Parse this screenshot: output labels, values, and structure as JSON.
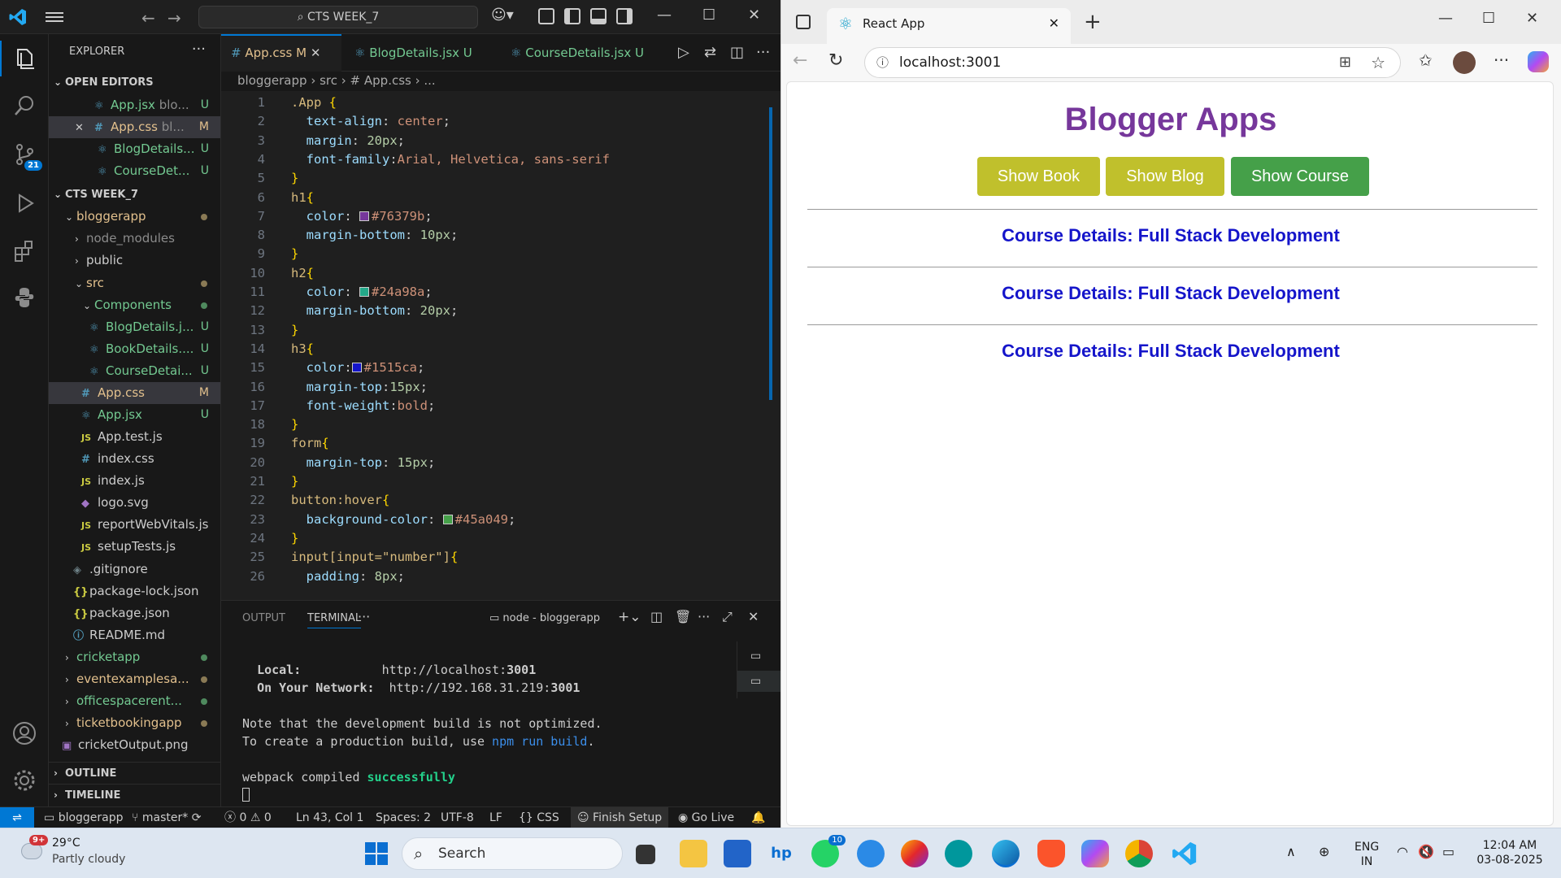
{
  "vscode": {
    "search_text": "CTS WEEK_7",
    "explorer_title": "EXPLORER",
    "open_editors_label": "OPEN EDITORS",
    "open_editors": [
      {
        "name": "App.jsx",
        "hint": "blo...",
        "status": "U"
      },
      {
        "name": "App.css",
        "hint": "bl...",
        "status": "M"
      },
      {
        "name": "BlogDetails...",
        "hint": "",
        "status": "U"
      },
      {
        "name": "CourseDet...",
        "hint": "",
        "status": "U"
      }
    ],
    "workspace_label": "CTS WEEK_7",
    "tree": [
      {
        "name": "bloggerapp",
        "kind": "folder-open"
      },
      {
        "name": "node_modules",
        "kind": "folder"
      },
      {
        "name": "public",
        "kind": "folder"
      },
      {
        "name": "src",
        "kind": "folder-open"
      },
      {
        "name": "Components",
        "kind": "folder-open"
      },
      {
        "name": "BlogDetails.j...",
        "status": "U"
      },
      {
        "name": "BookDetails....",
        "status": "U"
      },
      {
        "name": "CourseDetai...",
        "status": "U"
      },
      {
        "name": "App.css",
        "status": "M"
      },
      {
        "name": "App.jsx",
        "status": "U"
      },
      {
        "name": "App.test.js",
        "status": ""
      },
      {
        "name": "index.css",
        "status": ""
      },
      {
        "name": "index.js",
        "status": ""
      },
      {
        "name": "logo.svg",
        "status": ""
      },
      {
        "name": "reportWebVitals.js",
        "status": ""
      },
      {
        "name": "setupTests.js",
        "status": ""
      },
      {
        "name": ".gitignore",
        "status": ""
      },
      {
        "name": "package-lock.json",
        "status": ""
      },
      {
        "name": "package.json",
        "status": ""
      },
      {
        "name": "README.md",
        "status": ""
      },
      {
        "name": "cricketapp",
        "kind": "folder"
      },
      {
        "name": "eventexamplesa...",
        "kind": "folder"
      },
      {
        "name": "officespacerent...",
        "kind": "folder"
      },
      {
        "name": "ticketbookingapp",
        "kind": "folder"
      },
      {
        "name": "cricketOutput.png",
        "status": ""
      }
    ],
    "outline_label": "OUTLINE",
    "timeline_label": "TIMELINE",
    "source_control_badge": "21",
    "tabs": [
      {
        "name": "App.css",
        "status": "M"
      },
      {
        "name": "BlogDetails.jsx",
        "status": "U"
      },
      {
        "name": "CourseDetails.jsx",
        "status": "U"
      }
    ],
    "breadcrumb": [
      "bloggerapp",
      "src",
      "# App.css",
      "..."
    ],
    "code_lines": [
      ".App {",
      "  text-align: center;",
      "  margin: 20px;",
      "  font-family:Arial, Helvetica, sans-serif",
      "}",
      "h1{",
      "  color: #76379b;",
      "  margin-bottom: 10px;",
      "}",
      "h2{",
      "  color: #24a98a;",
      "  margin-bottom: 20px;",
      "}",
      "h3{",
      "  color:#1515ca;",
      "  margin-top:15px;",
      "  font-weight:bold;",
      "}",
      "form{",
      "  margin-top: 15px;",
      "}",
      "button:hover{",
      "  background-color: #45a049;",
      "}",
      "input[input=\"number\"]{",
      "  padding: 8px;"
    ],
    "panel": {
      "tabs": [
        "OUTPUT",
        "TERMINAL"
      ],
      "terminal_name": "node - bloggerapp",
      "local_label": "Local:",
      "local_url": "http://localhost:",
      "local_port": "3001",
      "network_label": "On Your Network:",
      "network_url": "http://192.168.31.219:",
      "network_port": "3001",
      "note1": "Note that the development build is not optimized.",
      "note2_prefix": "To create a production build, use ",
      "note2_cmd": "npm run build",
      "note2_suffix": ".",
      "compiled_prefix": "webpack compiled ",
      "compiled_status": "successfully"
    },
    "status": {
      "repo": "bloggerapp",
      "branch": "master*",
      "errors": "0",
      "warnings": "0",
      "position": "Ln 43, Col 1",
      "spaces": "Spaces: 2",
      "encoding": "UTF-8",
      "eol": "LF",
      "language": "CSS",
      "finish_setup": "Finish Setup",
      "go_live": "Go Live"
    }
  },
  "browser": {
    "tab_title": "React App",
    "url": "localhost:3001",
    "page": {
      "title": "Blogger Apps",
      "buttons": [
        "Show Book",
        "Show Blog",
        "Show Course"
      ],
      "button_colors": [
        "#c0c02c",
        "#c0c02c",
        "#45a049"
      ],
      "course_headings": [
        "Course Details: Full Stack Development",
        "Course Details: Full Stack Development",
        "Course Details: Full Stack Development"
      ]
    }
  },
  "taskbar": {
    "weather_temp": "29°C",
    "weather_desc": "Partly cloudy",
    "weather_badge": "9+",
    "search_placeholder": "Search",
    "whatsapp_badge": "10",
    "lang_line1": "ENG",
    "lang_line2": "IN",
    "time": "12:04 AM",
    "date": "03-08-2025"
  }
}
